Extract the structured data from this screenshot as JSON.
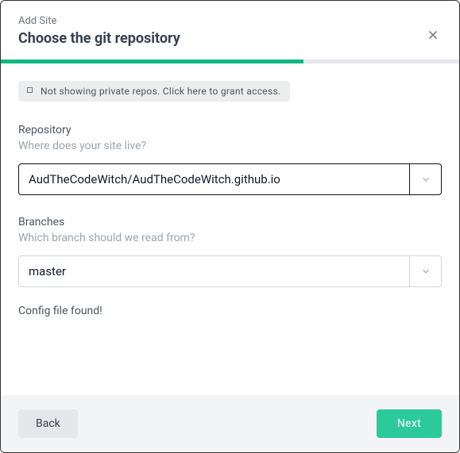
{
  "header": {
    "subtitle": "Add Site",
    "title": "Choose the git repository"
  },
  "notice": {
    "text": "Not showing private repos. Click here to grant access."
  },
  "repository": {
    "label": "Repository",
    "hint": "Where does your site live?",
    "value": "AudTheCodeWitch/AudTheCodeWitch.github.io"
  },
  "branches": {
    "label": "Branches",
    "hint": "Which branch should we read from?",
    "value": "master"
  },
  "status": {
    "text": "Config file found!"
  },
  "footer": {
    "back_label": "Back",
    "next_label": "Next"
  }
}
